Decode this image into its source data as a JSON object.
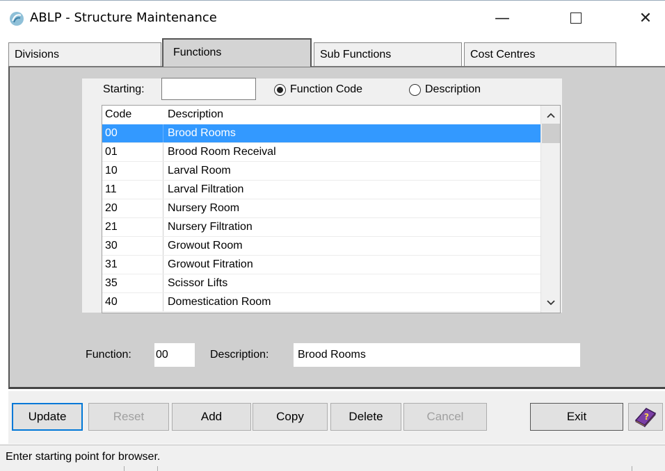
{
  "window": {
    "title": "ABLP - Structure Maintenance",
    "minimize": "—",
    "close": "✕"
  },
  "tabs": [
    {
      "label": "Divisions"
    },
    {
      "label": "Functions",
      "active": true
    },
    {
      "label": "Sub Functions"
    },
    {
      "label": "Cost Centres"
    }
  ],
  "browser": {
    "starting_label": "Starting:",
    "starting_value": "",
    "radio_function_code": "Function Code",
    "radio_description": "Description",
    "selected_radio": "Function Code",
    "columns": {
      "code": "Code",
      "description": "Description"
    },
    "rows": [
      {
        "code": "00",
        "description": "Brood Rooms",
        "selected": true
      },
      {
        "code": "01",
        "description": "Brood Room Receival"
      },
      {
        "code": "10",
        "description": "Larval Room"
      },
      {
        "code": "11",
        "description": "Larval Filtration"
      },
      {
        "code": "20",
        "description": "Nursery Room"
      },
      {
        "code": "21",
        "description": "Nursery Filtration"
      },
      {
        "code": "30",
        "description": "Growout Room"
      },
      {
        "code": "31",
        "description": "Growout Fitration"
      },
      {
        "code": "35",
        "description": "Scissor Lifts"
      },
      {
        "code": "40",
        "description": "Domestication Room"
      }
    ]
  },
  "detail": {
    "function_label": "Function:",
    "function_value": "00",
    "description_label": "Description:",
    "description_value": "Brood Rooms"
  },
  "buttons": {
    "update": "Update",
    "reset": "Reset",
    "add": "Add",
    "copy": "Copy",
    "delete": "Delete",
    "cancel": "Cancel",
    "exit": "Exit"
  },
  "status": {
    "text": "Enter starting point for browser."
  },
  "colors": {
    "selection": "#3399ff",
    "panel": "#cfcfcf",
    "default_button_border": "#0078d7"
  }
}
